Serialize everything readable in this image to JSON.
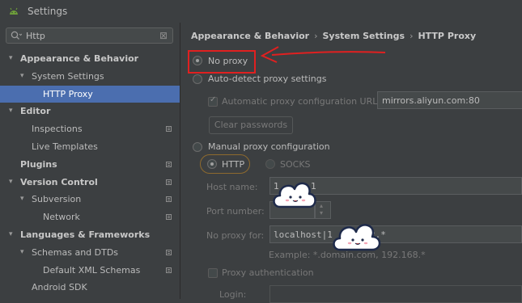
{
  "window": {
    "title": "Settings"
  },
  "search": {
    "query": "Http"
  },
  "tree": [
    {
      "label": "Appearance & Behavior",
      "bold": true,
      "arrow": "down",
      "indent": 0,
      "page": false,
      "selected": false
    },
    {
      "label": "System Settings",
      "bold": false,
      "arrow": "down",
      "indent": 1,
      "page": false,
      "selected": false
    },
    {
      "label": "HTTP Proxy",
      "bold": false,
      "arrow": "",
      "indent": 2,
      "page": false,
      "selected": true
    },
    {
      "label": "Editor",
      "bold": true,
      "arrow": "down",
      "indent": 0,
      "page": false,
      "selected": false
    },
    {
      "label": "Inspections",
      "bold": false,
      "arrow": "",
      "indent": 1,
      "page": true,
      "selected": false
    },
    {
      "label": "Live Templates",
      "bold": false,
      "arrow": "",
      "indent": 1,
      "page": false,
      "selected": false
    },
    {
      "label": "Plugins",
      "bold": true,
      "arrow": "",
      "indent": 0,
      "page": true,
      "selected": false
    },
    {
      "label": "Version Control",
      "bold": true,
      "arrow": "down",
      "indent": 0,
      "page": true,
      "selected": false
    },
    {
      "label": "Subversion",
      "bold": false,
      "arrow": "down",
      "indent": 1,
      "page": true,
      "selected": false
    },
    {
      "label": "Network",
      "bold": false,
      "arrow": "",
      "indent": 2,
      "page": true,
      "selected": false
    },
    {
      "label": "Languages & Frameworks",
      "bold": true,
      "arrow": "down",
      "indent": 0,
      "page": false,
      "selected": false
    },
    {
      "label": "Schemas and DTDs",
      "bold": false,
      "arrow": "down",
      "indent": 1,
      "page": true,
      "selected": false
    },
    {
      "label": "Default XML Schemas",
      "bold": false,
      "arrow": "",
      "indent": 2,
      "page": true,
      "selected": false
    },
    {
      "label": "Android SDK",
      "bold": false,
      "arrow": "",
      "indent": 1,
      "page": false,
      "selected": false
    }
  ],
  "breadcrumb": [
    "Appearance & Behavior",
    "System Settings",
    "HTTP Proxy"
  ],
  "proxy": {
    "no_proxy": "No proxy",
    "auto_detect": "Auto-detect proxy settings",
    "auto_config_label": "Automatic proxy configuration URL:",
    "auto_config_url": "mirrors.aliyun.com:80",
    "clear_passwords": "Clear passwords",
    "manual": "Manual proxy configuration",
    "http": "HTTP",
    "socks": "SOCKS",
    "host_label": "Host name:",
    "host_value": "1",
    "host_value_tail": "1",
    "port_label": "Port number:",
    "no_proxy_for_label": "No proxy for:",
    "no_proxy_for_value": "localhost|1",
    "no_proxy_for_tail": "2.*",
    "example": "Example: *.domain.com, 192.168.*",
    "proxy_auth": "Proxy authentication",
    "login_label": "Login:"
  },
  "colors": {
    "selection": "#4b6eaf",
    "annotation": "#e02020",
    "http_ring": "#8e6a2e",
    "background": "#3c3f41"
  },
  "icons": {
    "app": "android-icon",
    "search": "search-icon",
    "clear": "close-icon",
    "annotation_arrow": "red-arrow-annotation",
    "stickers": "cloud-sticker-icon"
  }
}
